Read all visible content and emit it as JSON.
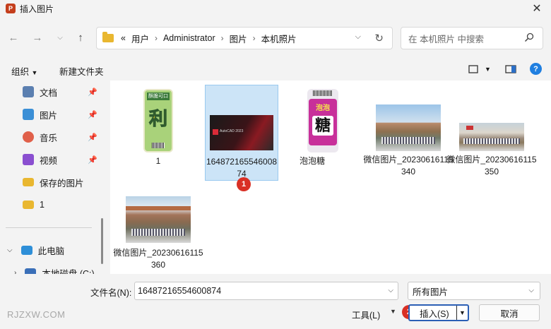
{
  "window": {
    "title": "插入图片",
    "app_icon_letter": "P"
  },
  "address": {
    "breadcrumbs": [
      "«",
      "用户",
      "Administrator",
      "图片",
      "本机照片"
    ]
  },
  "search": {
    "placeholder": "在 本机照片 中搜索"
  },
  "toolbar": {
    "organize": "组织",
    "new_folder": "新建文件夹",
    "help": "?"
  },
  "sidebar": {
    "items": [
      {
        "label": "文档",
        "icon": "document-icon",
        "color": "#5b7fb0",
        "pinned": true
      },
      {
        "label": "图片",
        "icon": "pictures-icon",
        "color": "#3b8fd6",
        "pinned": true
      },
      {
        "label": "音乐",
        "icon": "music-icon",
        "color": "#e0604a",
        "pinned": true
      },
      {
        "label": "视频",
        "icon": "video-icon",
        "color": "#8a4fd0",
        "pinned": true
      },
      {
        "label": "保存的图片",
        "icon": "folder-icon",
        "color": "#e9b730",
        "pinned": false
      },
      {
        "label": "1",
        "icon": "folder-icon",
        "color": "#e9b730",
        "pinned": false
      }
    ],
    "this_pc": "此电脑",
    "local_disk": "本地磁盘 (C:)"
  },
  "files": [
    {
      "name": "1",
      "selected": false
    },
    {
      "name": "16487216554600874",
      "selected": true
    },
    {
      "name": "泡泡糖",
      "selected": false
    },
    {
      "name": "微信图片_20230616115340",
      "selected": false
    },
    {
      "name": "微信图片_20230616115350",
      "selected": false
    },
    {
      "name": "微信图片_20230616115360",
      "selected": false
    }
  ],
  "thumb_text": {
    "sticker_1_top": "酥脆可口",
    "sticker_1_big": "利",
    "candy_top": "泡泡",
    "candy_big": "糖",
    "autocad": "AutoCAD 2023"
  },
  "bottom": {
    "filename_label": "文件名(N):",
    "filename_value": "16487216554600874",
    "filetype": "所有图片",
    "tools": "工具(L)",
    "insert": "插入(S)",
    "cancel": "取消"
  },
  "badges": {
    "step1": "1",
    "step2": "2"
  },
  "watermark": "RJZXW.COM",
  "colors": {
    "selection": "#cce4f7",
    "accent": "#2b5fb5",
    "badge": "#d93025"
  }
}
